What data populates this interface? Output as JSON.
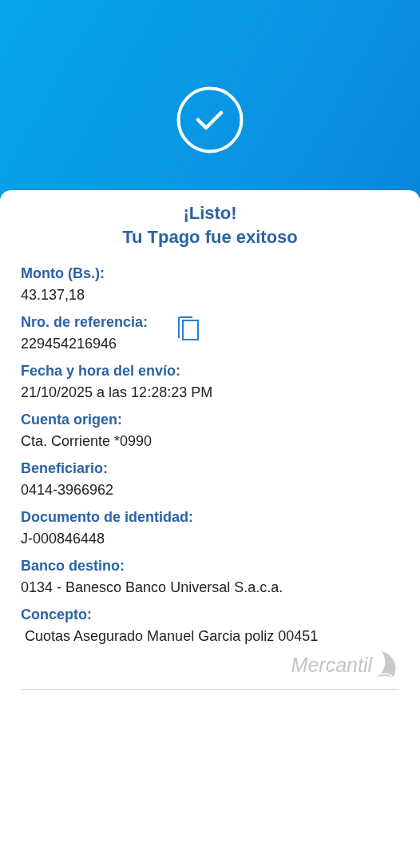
{
  "title": [
    "¡Listo!",
    "Tu Tpago fue exitoso"
  ],
  "fields": [
    {
      "label": "Monto (Bs.):",
      "value": "43.137,18",
      "copyable": false
    },
    {
      "label": "Nro. de referencia:",
      "value": "229454216946",
      "copyable": true
    },
    {
      "label": "Fecha y hora del envío:",
      "value": "21/10/2025 a las 12:28:23 PM",
      "copyable": false
    },
    {
      "label": "Cuenta origen:",
      "value": "Cta. Corriente *0990",
      "copyable": false
    },
    {
      "label": "Beneficiario:",
      "value": "0414-3966962",
      "copyable": false
    },
    {
      "label": "Documento de identidad:",
      "value": "J-000846448",
      "copyable": false
    },
    {
      "label": "Banco destino:",
      "value": "0134 - Banesco Banco Universal S.a.c.a.",
      "copyable": false
    },
    {
      "label": "Concepto:",
      "value": " Cuotas Asegurado Manuel Garcia poliz 00451",
      "copyable": false
    }
  ],
  "logo": {
    "text": "Mercantil"
  }
}
